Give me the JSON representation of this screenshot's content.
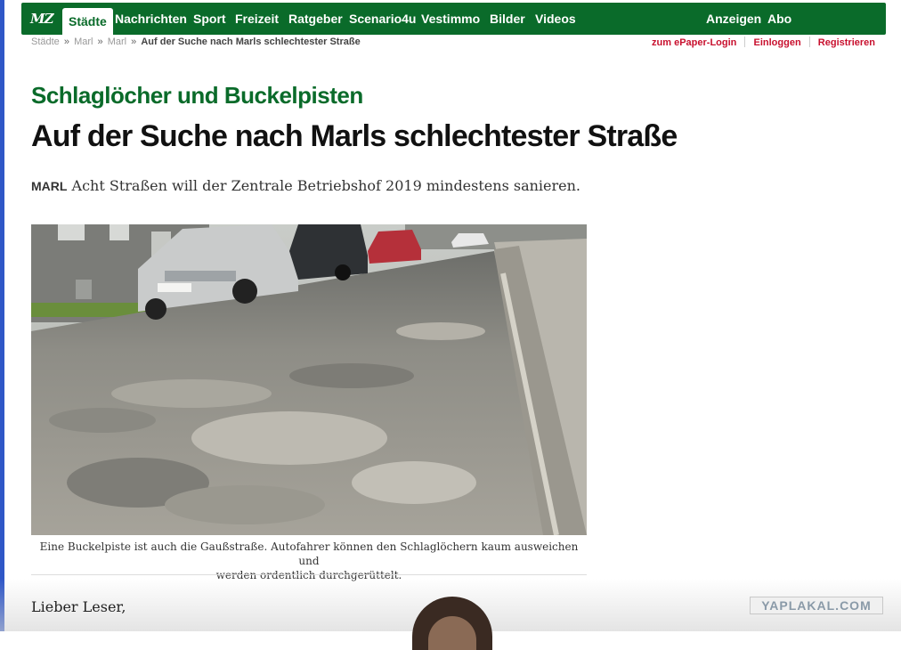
{
  "nav": {
    "logo": "MZ",
    "items": [
      "Städte",
      "Nachrichten",
      "Sport",
      "Freizeit",
      "Ratgeber",
      "Scenario4u",
      "Vestimmo",
      "Bilder",
      "Videos"
    ],
    "right_items": [
      "Anzeigen",
      "Abo"
    ],
    "active": "Städte"
  },
  "breadcrumb": {
    "items": [
      "Städte",
      "Marl",
      "Marl"
    ],
    "separator": "»",
    "current": "Auf der Suche nach Marls schlechtester Straße"
  },
  "account": {
    "epaper": "zum ePaper-Login",
    "login": "Einloggen",
    "register": "Registrieren"
  },
  "article": {
    "kicker": "Schlaglöcher und Buckelpisten",
    "title": "Auf der Suche nach Marls schlechtester Straße",
    "location": "MARL",
    "lead": "Acht Straßen will der Zentrale Betriebshof 2019 mindestens sanieren.",
    "caption_line1": "Eine Buckelpiste ist auch die Gaußstraße. Autofahrer können den Schlaglöchern kaum ausweichen und",
    "caption_line2": "werden ordentlich durchgerüttelt.",
    "greeting": "Lieber Leser,"
  },
  "watermark": "YAPLAKAL.COM",
  "colors": {
    "brand_green": "#0a6b2a",
    "link_red": "#c8102e"
  }
}
